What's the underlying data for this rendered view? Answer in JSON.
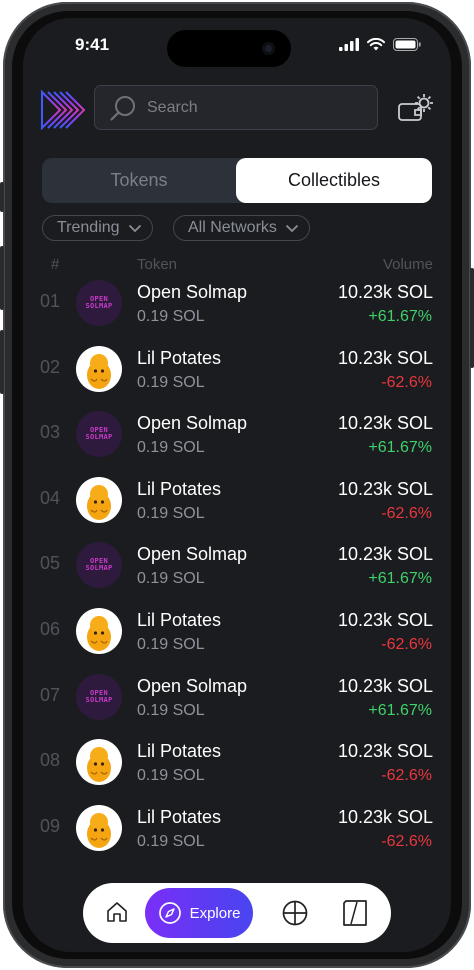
{
  "status_bar": {
    "time": "9:41"
  },
  "search": {
    "placeholder": "Search"
  },
  "tabs": [
    {
      "label": "Tokens",
      "active": false
    },
    {
      "label": "Collectibles",
      "active": true
    }
  ],
  "filters": {
    "sort": "Trending",
    "network": "All Networks"
  },
  "table": {
    "headers": {
      "rank": "#",
      "token": "Token",
      "volume": "Volume"
    },
    "rows": [
      {
        "rank": "01",
        "name": "Open Solmap",
        "price": "0.19 SOL",
        "volume": "10.23k SOL",
        "change": "+61.67%",
        "direction": "up",
        "avatar": "open-solmap"
      },
      {
        "rank": "02",
        "name": "Lil Potates",
        "price": "0.19 SOL",
        "volume": "10.23k SOL",
        "change": "-62.6%",
        "direction": "down",
        "avatar": "lil-potates"
      },
      {
        "rank": "03",
        "name": "Open Solmap",
        "price": "0.19 SOL",
        "volume": "10.23k SOL",
        "change": "+61.67%",
        "direction": "up",
        "avatar": "open-solmap"
      },
      {
        "rank": "04",
        "name": "Lil Potates",
        "price": "0.19 SOL",
        "volume": "10.23k SOL",
        "change": "-62.6%",
        "direction": "down",
        "avatar": "lil-potates"
      },
      {
        "rank": "05",
        "name": "Open Solmap",
        "price": "0.19 SOL",
        "volume": "10.23k SOL",
        "change": "+61.67%",
        "direction": "up",
        "avatar": "open-solmap"
      },
      {
        "rank": "06",
        "name": "Lil Potates",
        "price": "0.19 SOL",
        "volume": "10.23k SOL",
        "change": "-62.6%",
        "direction": "down",
        "avatar": "lil-potates"
      },
      {
        "rank": "07",
        "name": "Open Solmap",
        "price": "0.19 SOL",
        "volume": "10.23k SOL",
        "change": "+61.67%",
        "direction": "up",
        "avatar": "open-solmap"
      },
      {
        "rank": "08",
        "name": "Lil Potates",
        "price": "0.19 SOL",
        "volume": "10.23k SOL",
        "change": "-62.6%",
        "direction": "down",
        "avatar": "lil-potates"
      },
      {
        "rank": "09",
        "name": "Lil Potates",
        "price": "0.19 SOL",
        "volume": "10.23k SOL",
        "change": "-62.6%",
        "direction": "down",
        "avatar": "lil-potates"
      }
    ]
  },
  "avatar_text": {
    "open_solmap_line1": "OPEN",
    "open_solmap_line2": "SOLMAP"
  },
  "bottom_nav": {
    "items": [
      {
        "icon": "home-icon",
        "label": "",
        "active": false
      },
      {
        "icon": "compass-icon",
        "label": "Explore",
        "active": true
      },
      {
        "icon": "crosshair-icon",
        "label": "",
        "active": false
      },
      {
        "icon": "card-icon",
        "label": "",
        "active": false
      }
    ]
  },
  "colors": {
    "positive": "#3fd16a",
    "negative": "#e8383d",
    "accent": "#6a36f5",
    "background": "#1b1c20"
  }
}
